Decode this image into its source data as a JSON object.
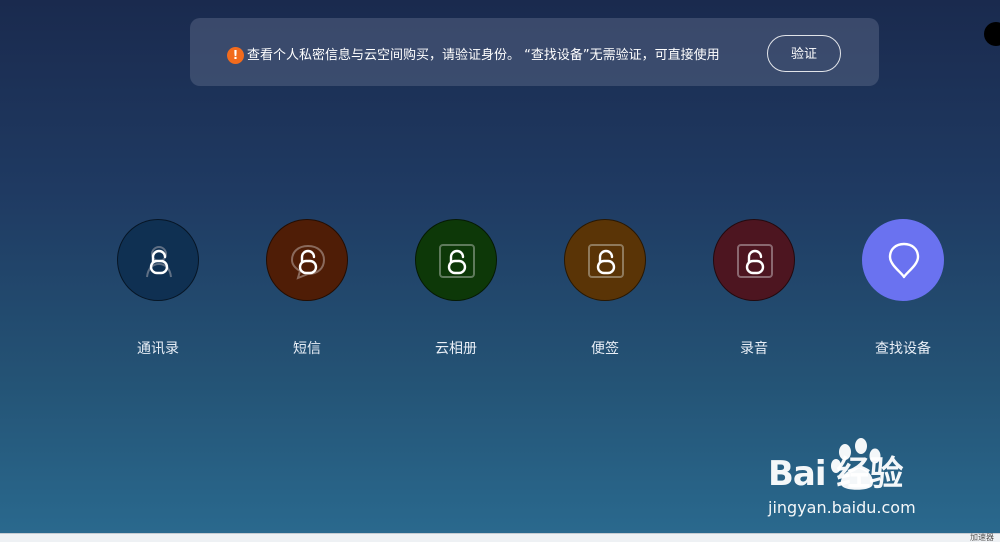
{
  "banner": {
    "warning_icon": "exclamation-icon",
    "warning_color": "#f26b1d",
    "message": "查看个人私密信息与云空间购买，请验证身份。 “查找设备”无需验证，可直接使用",
    "verify_label": "验证"
  },
  "apps": [
    {
      "id": "contacts",
      "label": "通讯录",
      "icon": "lock-contacts-icon",
      "color": "#0f3052",
      "locked": true
    },
    {
      "id": "sms",
      "label": "短信",
      "icon": "lock-message-icon",
      "color": "#4f1d06",
      "locked": true
    },
    {
      "id": "gallery",
      "label": "云相册",
      "icon": "lock-gallery-icon",
      "color": "#0d3808",
      "locked": true
    },
    {
      "id": "notes",
      "label": "便签",
      "icon": "lock-notes-icon",
      "color": "#5a3406",
      "locked": true
    },
    {
      "id": "recorder",
      "label": "录音",
      "icon": "lock-recorder-icon",
      "color": "#4d1520",
      "locked": true
    },
    {
      "id": "find-device",
      "label": "查找设备",
      "icon": "location-pin-icon",
      "color": "#6a72f0",
      "locked": false
    }
  ],
  "watermark": {
    "logo_text": "Bai 经验",
    "url": "jingyan.baidu.com"
  },
  "status_strip": {
    "text": "加速器"
  }
}
